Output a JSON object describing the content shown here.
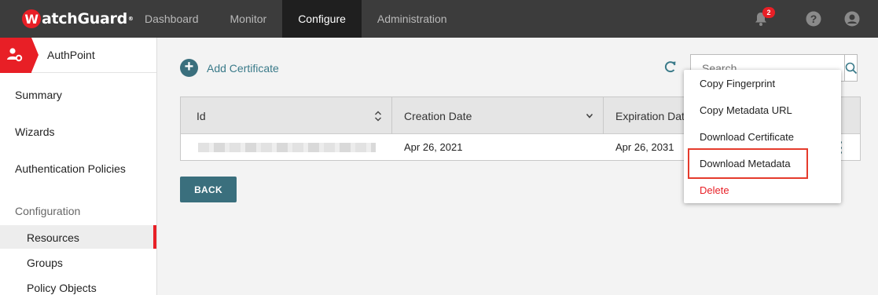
{
  "brand": {
    "name": "WatchGuard",
    "logo_letter": "W",
    "logo_rest": "atchGuard",
    "reg": "®"
  },
  "nav": {
    "tabs": [
      "Dashboard",
      "Monitor",
      "Configure",
      "Administration"
    ],
    "active": "Configure",
    "notifications_count": "2"
  },
  "sidebar": {
    "product": "AuthPoint",
    "items": [
      "Summary",
      "Wizards",
      "Authentication Policies"
    ],
    "section": "Configuration",
    "sub_items": [
      "Resources",
      "Groups",
      "Policy Objects"
    ],
    "active_sub": "Resources"
  },
  "toolbar": {
    "add_label": "Add Certificate",
    "search_placeholder": "Search"
  },
  "table": {
    "columns": [
      "Id",
      "Creation Date",
      "Expiration Date"
    ],
    "rows": [
      {
        "id": "",
        "creation": "Apr 26, 2021",
        "expiration": "Apr 26, 2031"
      }
    ]
  },
  "back_label": "BACK",
  "menu": {
    "items": [
      "Copy Fingerprint",
      "Copy Metadata URL",
      "Download Certificate",
      "Download Metadata",
      "Delete"
    ],
    "highlighted": "Download Metadata"
  },
  "colors": {
    "brand_red": "#e81f26",
    "accent_teal": "#3a6f7d",
    "topbar": "#3c3c3c"
  }
}
